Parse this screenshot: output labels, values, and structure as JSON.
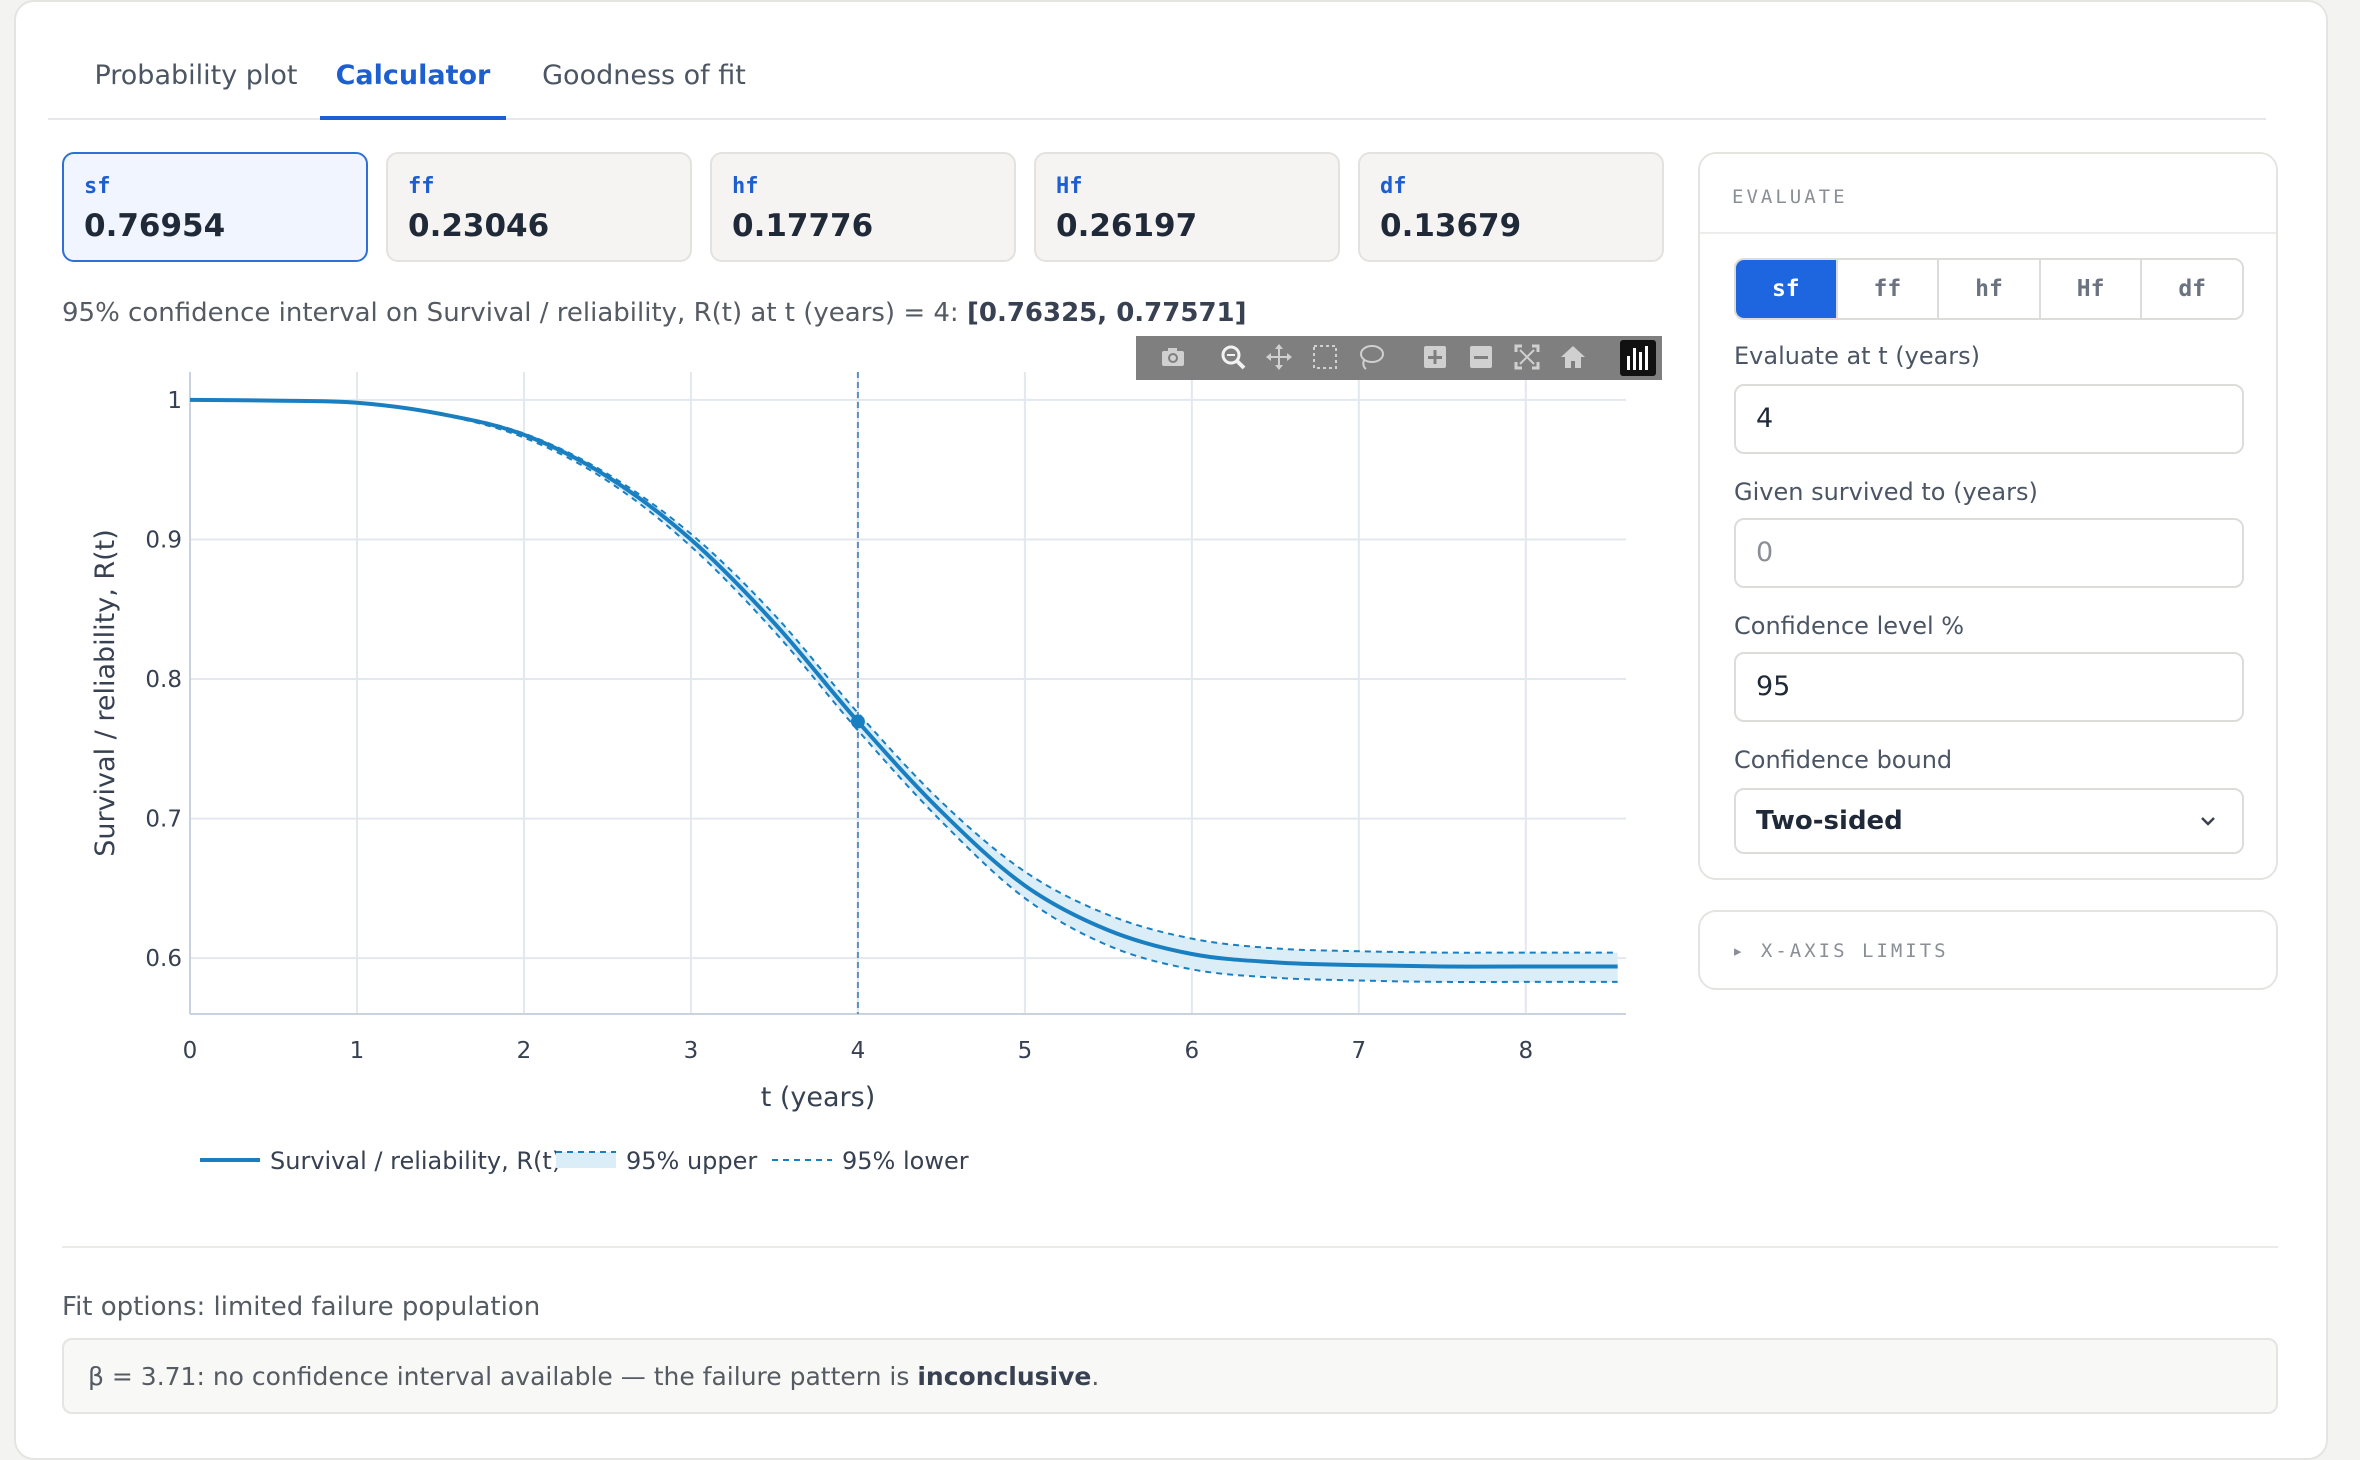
{
  "tabs": [
    {
      "label": "Probability plot",
      "active": false
    },
    {
      "label": "Calculator",
      "active": true
    },
    {
      "label": "Goodness of fit",
      "active": false
    }
  ],
  "metrics": [
    {
      "key": "sf",
      "value": "0.76954",
      "active": true
    },
    {
      "key": "ff",
      "value": "0.23046",
      "active": false
    },
    {
      "key": "hf",
      "value": "0.17776",
      "active": false
    },
    {
      "key": "Hf",
      "value": "0.26197",
      "active": false
    },
    {
      "key": "df",
      "value": "0.13679",
      "active": false
    }
  ],
  "ci": {
    "prefix": "95% confidence interval on Survival / reliability, R(t) at t (years) = 4: ",
    "value": "[0.76325, 0.77571]"
  },
  "modebar_icons": [
    "camera-icon",
    "zoom-icon",
    "pan-icon",
    "box-select-icon",
    "lasso-icon",
    "zoom-in-icon",
    "zoom-out-icon",
    "autoscale-icon",
    "home-icon",
    "plotly-logo-icon"
  ],
  "chart_data": {
    "type": "line",
    "xlabel": "t (years)",
    "ylabel": "Survival / reliability, R(t)",
    "xlim": [
      0,
      8.6
    ],
    "ylim": [
      0.56,
      1.02
    ],
    "xticks": [
      "0",
      "1",
      "2",
      "3",
      "4",
      "5",
      "6",
      "7",
      "8"
    ],
    "yticks": [
      "0.6",
      "0.7",
      "0.8",
      "0.9",
      "1"
    ],
    "grid": true,
    "vline_x": 4,
    "marker": {
      "x": 4,
      "y": 0.76954
    },
    "legend_position": "bottom-left",
    "x": [
      0,
      0.5,
      1,
      1.5,
      2,
      2.5,
      3,
      3.5,
      4,
      4.5,
      5,
      5.5,
      6,
      6.5,
      7,
      7.5,
      8,
      8.55
    ],
    "series": [
      {
        "name": "Survival / reliability, R(t)",
        "style": "solid",
        "color": "#1a7fc1",
        "values": [
          1.0,
          0.9995,
          0.998,
          0.99,
          0.975,
          0.945,
          0.9,
          0.84,
          0.76954,
          0.705,
          0.652,
          0.62,
          0.603,
          0.597,
          0.595,
          0.594,
          0.594,
          0.594
        ]
      },
      {
        "name": "95% upper",
        "style": "dashed",
        "color": "#1a7fc1",
        "fill": "#dbeef8",
        "values": [
          1.0,
          0.9996,
          0.9983,
          0.9905,
          0.976,
          0.947,
          0.904,
          0.846,
          0.77571,
          0.712,
          0.662,
          0.631,
          0.614,
          0.607,
          0.605,
          0.604,
          0.604,
          0.604
        ]
      },
      {
        "name": "95% lower",
        "style": "dashed",
        "color": "#1a7fc1",
        "values": [
          1.0,
          0.9994,
          0.9977,
          0.9895,
          0.973,
          0.942,
          0.895,
          0.834,
          0.76325,
          0.698,
          0.643,
          0.609,
          0.592,
          0.586,
          0.584,
          0.583,
          0.583,
          0.583
        ]
      }
    ]
  },
  "evaluate": {
    "title": "EVALUATE",
    "segments": [
      {
        "label": "sf",
        "active": true
      },
      {
        "label": "ff",
        "active": false
      },
      {
        "label": "hf",
        "active": false
      },
      {
        "label": "Hf",
        "active": false
      },
      {
        "label": "df",
        "active": false
      }
    ],
    "t_label": "Evaluate at t (years)",
    "t_value": "4",
    "given_label": "Given survived to (years)",
    "given_value": "0",
    "conf_label": "Confidence level %",
    "conf_value": "95",
    "bound_label": "Confidence bound",
    "bound_value": "Two-sided"
  },
  "xlimits": {
    "label": "▸ X-AXIS LIMITS"
  },
  "fit": {
    "label": "Fit options: limited failure population",
    "note_prefix": "β = 3.71: no confidence interval available — the failure pattern is ",
    "note_bold": "inconclusive",
    "note_suffix": "."
  }
}
